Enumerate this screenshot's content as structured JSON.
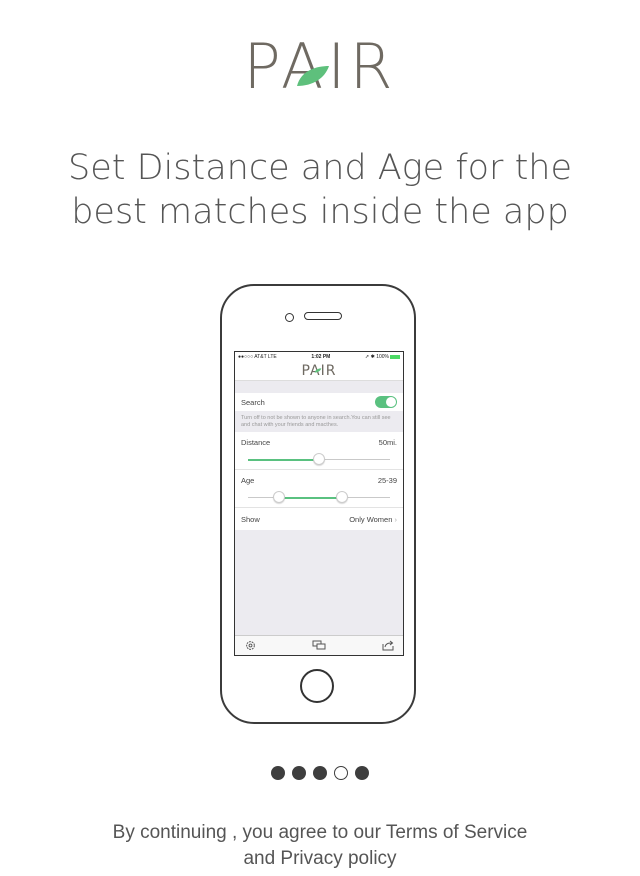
{
  "logo": {
    "text": "PAIR",
    "leaf_color": "#5ec07c",
    "text_color": "#6f6a62"
  },
  "headline": {
    "line1": "Set Distance and Age for the",
    "line2": "best matches inside the app"
  },
  "phone_screen": {
    "status": {
      "carrier": "●●○○○ AT&T  LTE",
      "time": "1:02 PM",
      "battery": "➚ ✱ 100%"
    },
    "nav_logo": "PAIR",
    "search": {
      "label": "Search",
      "enabled": true,
      "hint": "Turn off to not be shown to anyone in search.You can still see and chat with your friends and macthes."
    },
    "distance": {
      "label": "Distance",
      "value_text": "50mi.",
      "level": 0.5
    },
    "age": {
      "label": "Age",
      "value_text": "25-39",
      "low_level": 0.22,
      "high_level": 0.66
    },
    "show": {
      "label": "Show",
      "value_text": "Only Women"
    },
    "tabs": [
      "settings-icon",
      "chat-icon",
      "share-icon"
    ],
    "accent": "#5ac180"
  },
  "pagination": {
    "count": 5,
    "active_index": 3
  },
  "footer": {
    "line1": "By continuing , you agree to our Terms of Service",
    "line2": "and Privacy policy"
  }
}
